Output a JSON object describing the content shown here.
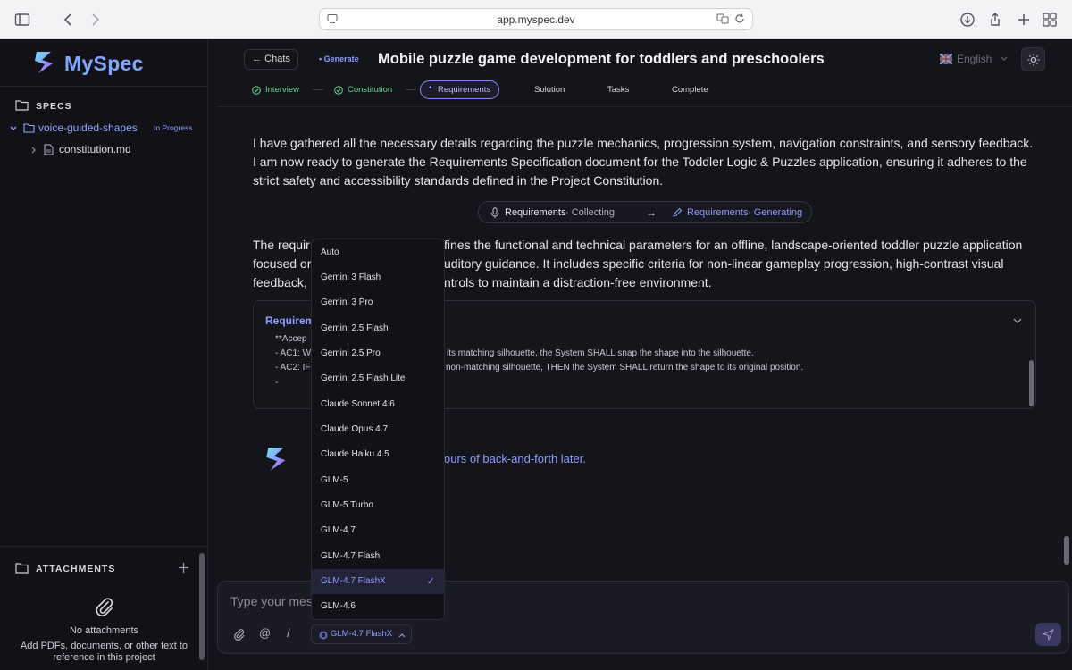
{
  "browser": {
    "url": "app.myspec.dev"
  },
  "sidebar": {
    "app_name": "MySpec",
    "specs_title": "SPECS",
    "spec": {
      "name": "voice-guided-shapes",
      "status": "In Progress"
    },
    "file": "constitution.md",
    "attachments_title": "ATTACHMENTS",
    "attachments_empty_title": "No attachments",
    "attachments_empty_desc_1": "Add PDFs, documents, or other text to",
    "attachments_empty_desc_2": "reference in this project"
  },
  "header": {
    "back_label": "Chats",
    "mode_tag": "Generate",
    "title": "Mobile puzzle game development for toddlers and preschoolers",
    "language": "English",
    "steps": [
      "Interview",
      "Constitution",
      "Requirements",
      "Solution",
      "Tasks",
      "Complete"
    ]
  },
  "chat": {
    "para1": "I have gathered all the necessary details regarding the puzzle mechanics, progression system, navigation constraints, and sensory feedback. I am now ready to generate the Requirements Specification document for the Toddler Logic & Puzzles application, ensuring it adheres to the strict safety and accessibility standards defined in the Project Constitution.",
    "status_from": "Requirements",
    "status_from_state": "· Collecting",
    "status_to": "Requirements",
    "status_to_state": "· Generating",
    "para2_a": "The requir",
    "para2_b": "fines the functional and technical parameters for an offline, landscape-oriented toddler puzzle application",
    "para2_c": "focused or",
    "para2_d": "uditory guidance. It includes specific criteria for non-linear gameplay progression, high-contrast visual",
    "para2_e": "feedback,",
    "para2_f": "ntrols to maintain a distraction-free environment.",
    "card_title": "Requirem",
    "code1": "**Accep",
    "code2": "- AC1: W",
    "code2b": "its matching silhouette, the System SHALL snap the shape into the silhouette.",
    "code3": "- AC2: IF",
    "code3b": "non-matching silhouette, THEN the System SHALL return the shape to its original position.",
    "code4": "-",
    "assistant_snippet": "ours of back-and-forth later."
  },
  "dropdown": {
    "items": [
      "Auto",
      "Gemini 3 Flash",
      "Gemini 3 Pro",
      "Gemini 2.5 Flash",
      "Gemini 2.5 Pro",
      "Gemini 2.5 Flash Lite",
      "Claude Sonnet 4.6",
      "Claude Opus 4.7",
      "Claude Haiku 4.5",
      "GLM-5",
      "GLM-5 Turbo",
      "GLM-4.7",
      "GLM-4.7 Flash",
      "GLM-4.7 FlashX",
      "GLM-4.6"
    ],
    "selected": "GLM-4.7 FlashX"
  },
  "composer": {
    "placeholder": "Type your mes",
    "model": "GLM-4.7 FlashX",
    "slash": "/"
  },
  "colors": {
    "accent": "#8e9cff",
    "success": "#6bd68b",
    "bg": "#14141b"
  }
}
